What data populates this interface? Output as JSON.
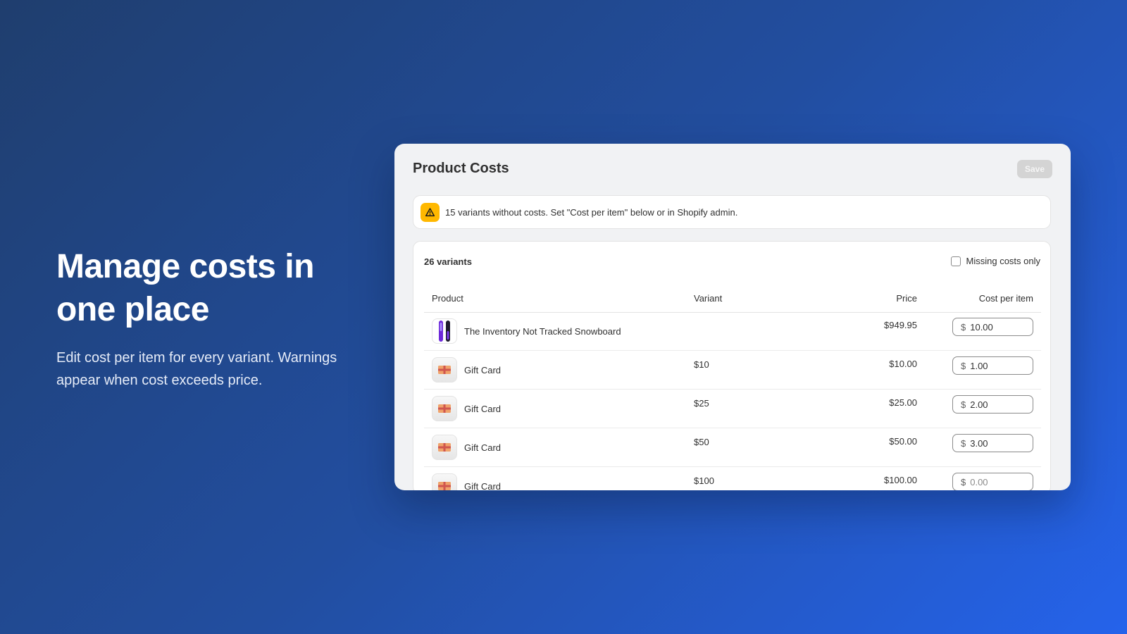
{
  "hero": {
    "title": "Manage costs in one place",
    "subtitle": "Edit cost per item for every variant. Warnings appear when cost exceeds price."
  },
  "app": {
    "title": "Product Costs",
    "save_label": "Save",
    "banner": {
      "icon": "warning-icon",
      "text": "15 variants without costs. Set \"Cost per item\" below or in Shopify admin."
    },
    "card": {
      "count_label": "26 variants",
      "filter_label": "Missing costs only",
      "filter_checked": false,
      "columns": {
        "product": "Product",
        "variant": "Variant",
        "price": "Price",
        "cost": "Cost per item"
      },
      "rows": [
        {
          "product": "The Inventory Not Tracked Snowboard",
          "variant": "",
          "price": "$949.95",
          "currency": "$",
          "cost": "10.00",
          "thumb": "snowboard-thumbnail"
        },
        {
          "product": "Gift Card",
          "variant": "$10",
          "price": "$10.00",
          "currency": "$",
          "cost": "1.00",
          "thumb": "gift-card-thumbnail"
        },
        {
          "product": "Gift Card",
          "variant": "$25",
          "price": "$25.00",
          "currency": "$",
          "cost": "2.00",
          "thumb": "gift-card-thumbnail"
        },
        {
          "product": "Gift Card",
          "variant": "$50",
          "price": "$50.00",
          "currency": "$",
          "cost": "3.00",
          "thumb": "gift-card-thumbnail"
        },
        {
          "product": "Gift Card",
          "variant": "$100",
          "price": "$100.00",
          "currency": "$",
          "cost": "0.00",
          "thumb": "gift-card-thumbnail"
        }
      ]
    }
  },
  "colors": {
    "background_start": "#1f3e6e",
    "background_end": "#2563eb",
    "warning": "#ffb800",
    "save_disabled": "#d4d4d4"
  }
}
